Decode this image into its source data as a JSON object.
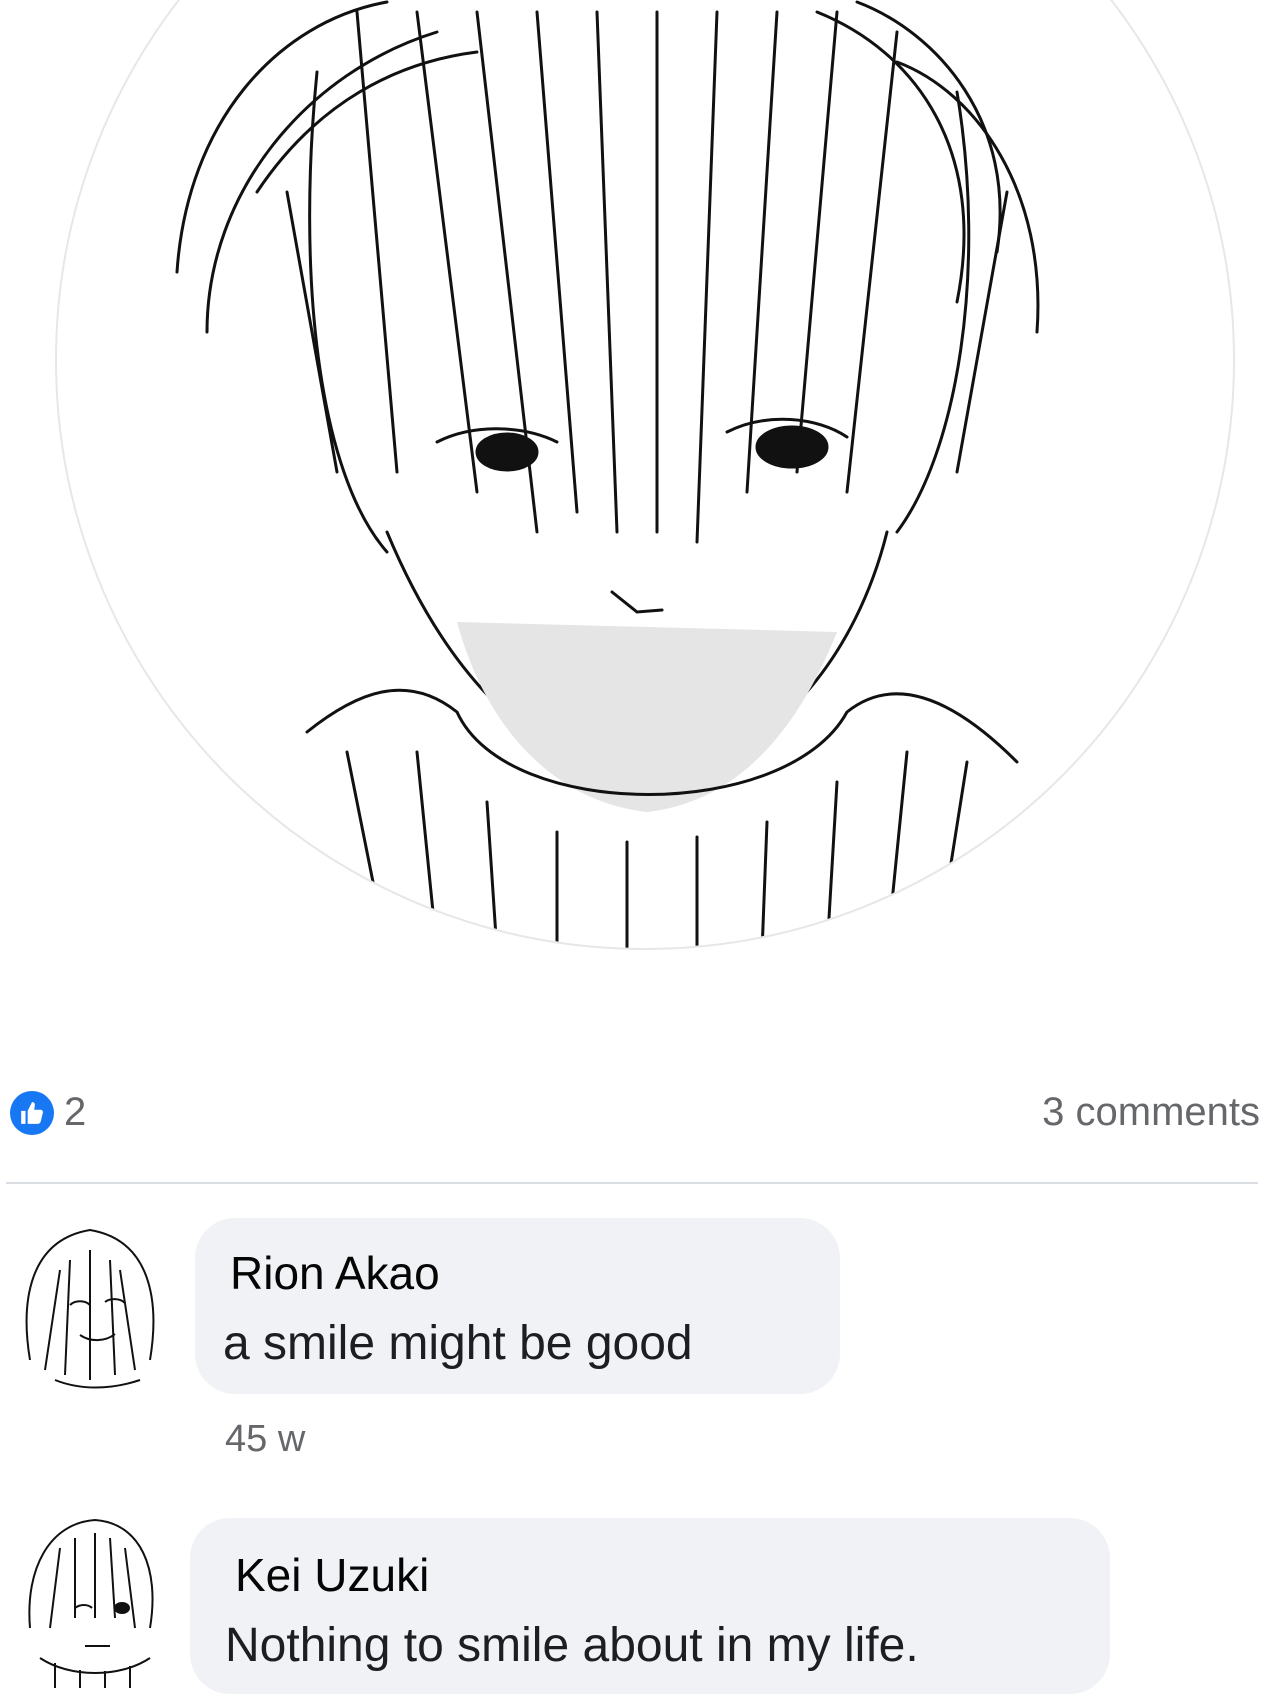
{
  "post": {
    "reactions": {
      "icon": "like-icon",
      "count": "2"
    },
    "comments_count": "3 comments"
  },
  "comments": [
    {
      "author": "Rion Akao",
      "text": "a smile might be good",
      "time": "45 w"
    },
    {
      "author": "Kei Uzuki",
      "text": "Nothing to smile about in my life."
    }
  ],
  "colors": {
    "accent": "#1877f2",
    "bubble": "#f0f2f5",
    "meta": "#65676b"
  }
}
